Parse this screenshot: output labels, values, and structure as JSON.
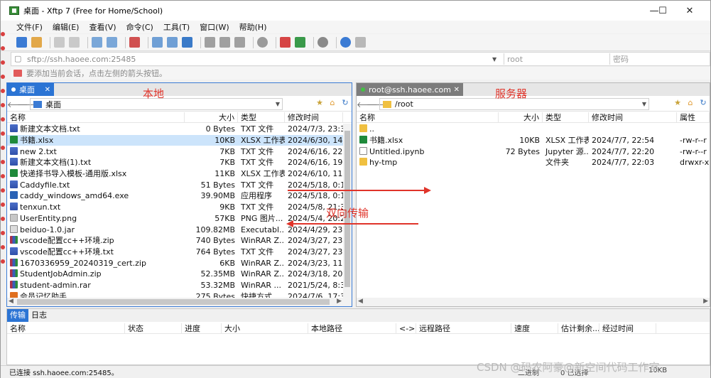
{
  "window": {
    "title": "桌面 - Xftp 7 (Free for Home/School)",
    "controls": {
      "minimize": "—",
      "maximize": "☐",
      "close": "✕"
    }
  },
  "menu": [
    "文件(F)",
    "编辑(E)",
    "查看(V)",
    "命令(C)",
    "工具(T)",
    "窗口(W)",
    "帮助(H)"
  ],
  "address": {
    "value": "sftp://ssh.haoee.com:25485",
    "user_placeholder": "root",
    "password_placeholder": "密码"
  },
  "hint": "要添加当前会话，点击左侧的箭头按钮。",
  "left_pane": {
    "tab": "桌面",
    "path": "桌面",
    "columns": [
      "名称",
      "大小",
      "类型",
      "修改时间"
    ],
    "files": [
      {
        "icon": "txt",
        "name": "新建文本文档.txt",
        "size": "0 Bytes",
        "type": "TXT 文件",
        "modified": "2024/7/3, 23:38"
      },
      {
        "icon": "xlsx",
        "name": "书籍.xlsx",
        "size": "10KB",
        "type": "XLSX 工作表",
        "modified": "2024/6/30, 14:59",
        "selected": true
      },
      {
        "icon": "txt",
        "name": "new 2.txt",
        "size": "7KB",
        "type": "TXT 文件",
        "modified": "2024/6/16, 22:19"
      },
      {
        "icon": "txt",
        "name": "新建文本文档(1).txt",
        "size": "7KB",
        "type": "TXT 文件",
        "modified": "2024/6/16, 19:49"
      },
      {
        "icon": "xlsx",
        "name": "快递择书导入模板-通用版.xlsx",
        "size": "11KB",
        "type": "XLSX 工作表",
        "modified": "2024/6/10, 11:35"
      },
      {
        "icon": "txt",
        "name": "Caddyfile.txt",
        "size": "51 Bytes",
        "type": "TXT 文件",
        "modified": "2024/5/18, 0:18"
      },
      {
        "icon": "exe",
        "name": "caddy_windows_amd64.exe",
        "size": "39.90MB",
        "type": "应用程序",
        "modified": "2024/5/18, 0:14"
      },
      {
        "icon": "txt",
        "name": "tenxun.txt",
        "size": "9KB",
        "type": "TXT 文件",
        "modified": "2024/5/8, 21:30"
      },
      {
        "icon": "png",
        "name": "UserEntity.png",
        "size": "57KB",
        "type": "PNG 图片...",
        "modified": "2024/5/4, 20:23"
      },
      {
        "icon": "jar",
        "name": "beiduo-1.0.jar",
        "size": "109.82MB",
        "type": "Executabl...",
        "modified": "2024/4/29, 23:39"
      },
      {
        "icon": "zip",
        "name": "vscode配置cc++环境.zip",
        "size": "740 Bytes",
        "type": "WinRAR Z...",
        "modified": "2024/3/27, 23:20"
      },
      {
        "icon": "txt",
        "name": "vscode配置cc++环境.txt",
        "size": "764 Bytes",
        "type": "TXT 文件",
        "modified": "2024/3/27, 23:19"
      },
      {
        "icon": "zip",
        "name": "1670336959_20240319_cert.zip",
        "size": "6KB",
        "type": "WinRAR Z...",
        "modified": "2024/3/23, 11:46"
      },
      {
        "icon": "zip",
        "name": "StudentJobAdmin.zip",
        "size": "52.35MB",
        "type": "WinRAR Z...",
        "modified": "2024/3/18, 20:22"
      },
      {
        "icon": "rar",
        "name": "student-admin.rar",
        "size": "53.32MB",
        "type": "WinRAR ...",
        "modified": "2021/5/24, 8:33"
      },
      {
        "icon": "misc",
        "name": "会员记忆助手",
        "size": "275 Bytes",
        "type": "快捷方式",
        "modified": "2024/7/6, 17:30"
      }
    ]
  },
  "right_pane": {
    "tab": "root@ssh.haoee.com",
    "path": "/root",
    "columns": [
      "名称",
      "大小",
      "类型",
      "修改时间",
      "属性"
    ],
    "files": [
      {
        "icon": "folder",
        "name": "..",
        "size": "",
        "type": "",
        "modified": "",
        "perm": ""
      },
      {
        "icon": "xlsx",
        "name": "书籍.xlsx",
        "size": "10KB",
        "type": "XLSX 工作表",
        "modified": "2024/7/7, 22:54",
        "perm": "-rw-r--r"
      },
      {
        "icon": "ipynb",
        "name": "Untitled.ipynb",
        "size": "72 Bytes",
        "type": "Jupyter 源...",
        "modified": "2024/7/7, 22:20",
        "perm": "-rw-r--r"
      },
      {
        "icon": "folder",
        "name": "hy-tmp",
        "size": "",
        "type": "文件夹",
        "modified": "2024/7/7, 22:03",
        "perm": "drwxr-x"
      }
    ]
  },
  "annotations": {
    "local": "本地",
    "server": "服务器",
    "bidirectional": "双向传输"
  },
  "transfer": {
    "tabs": [
      "传输",
      "日志"
    ],
    "columns": [
      "名称",
      "状态",
      "进度",
      "大小",
      "本地路径",
      "<->",
      "远程路径",
      "速度",
      "估计剩余...",
      "经过时间"
    ]
  },
  "status": {
    "text": "已连接 ssh.haoee.com:25485。",
    "right1": "二进制",
    "right2": "0 已选择",
    "right3": "10KB",
    "watermark": "CSDN @码农阿豪@新空间代码工作室"
  }
}
